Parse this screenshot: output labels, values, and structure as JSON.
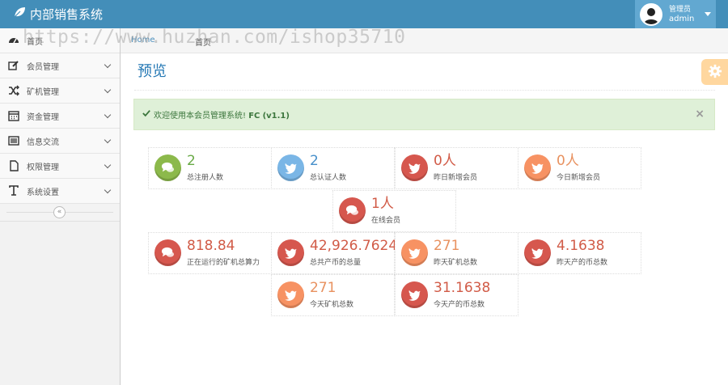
{
  "app": {
    "title": "内部销售系统"
  },
  "user": {
    "role": "管理员",
    "name": "admin"
  },
  "sidebar": {
    "items": [
      {
        "label": "首页",
        "icon": "tachometer-icon"
      },
      {
        "label": "会员管理",
        "icon": "edit-icon"
      },
      {
        "label": "矿机管理",
        "icon": "random-icon"
      },
      {
        "label": "资金管理",
        "icon": "calendar-icon"
      },
      {
        "label": "信息交流",
        "icon": "list-alt-icon"
      },
      {
        "label": "权限管理",
        "icon": "file-icon"
      },
      {
        "label": "系统设置",
        "icon": "text-icon"
      }
    ],
    "collapse": "«"
  },
  "breadcrumbs": {
    "home": "Home",
    "current": "首页"
  },
  "watermark": "https://www.huzhan.com/ishop35710",
  "page": {
    "title": "预览"
  },
  "alert": {
    "prefix": "欢迎使用本会员管理系统!",
    "brand": "FC",
    "version": "(v1.1)",
    "close": "×"
  },
  "stats": [
    {
      "value": "2",
      "label": "总注册人数",
      "color": "green",
      "icon": "comments-icon"
    },
    {
      "value": "2",
      "label": "总认证人数",
      "color": "blue",
      "icon": "twitter-icon"
    },
    {
      "value": "0人",
      "label": "昨日新增会员",
      "color": "red",
      "icon": "twitter-icon"
    },
    {
      "value": "0人",
      "label": "今日新增会员",
      "color": "orange",
      "icon": "twitter-icon"
    },
    {
      "value": "1人",
      "label": "在线会员",
      "color": "red",
      "icon": "comments-icon"
    },
    {
      "value": "818.84",
      "label": "正在运行的矿机总算力",
      "color": "red",
      "icon": "comments-icon"
    },
    {
      "value": "42,926.7624",
      "label": "总共产币的总量",
      "color": "red",
      "icon": "twitter-icon"
    },
    {
      "value": "271",
      "label": "昨天矿机总数",
      "color": "orange",
      "icon": "twitter-icon"
    },
    {
      "value": "4.1638",
      "label": "昨天产的币总数",
      "color": "red",
      "icon": "twitter-icon"
    },
    {
      "value": "271",
      "label": "今天矿机总数",
      "color": "orange",
      "icon": "twitter-icon"
    },
    {
      "value": "31.1638",
      "label": "今天产的币总数",
      "color": "red",
      "icon": "twitter-icon"
    }
  ],
  "colors": {
    "navbar": "#438eb9",
    "accent": "#2679b5",
    "green": "#8cb94b",
    "blue": "#7ab6e6",
    "red": "#d6574e",
    "orange": "#f79263"
  }
}
